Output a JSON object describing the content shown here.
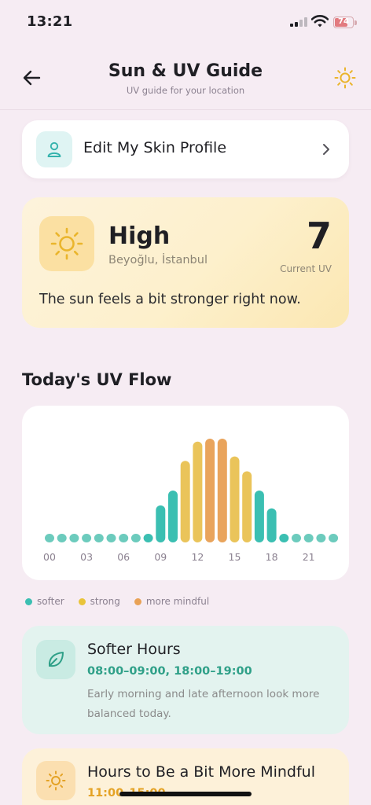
{
  "status_bar": {
    "time": "13:21",
    "battery": "74",
    "battery_level": 0.74
  },
  "header": {
    "title": "Sun & UV Guide",
    "subtitle": "UV guide for your location",
    "back_icon": "arrow-left-icon",
    "action_icon": "sun-icon"
  },
  "profile_card": {
    "label": "Edit My Skin Profile",
    "icon": "person-icon",
    "chevron": "chevron-right-icon"
  },
  "uv_card": {
    "level": "High",
    "location": "Beyoğlu, İstanbul",
    "value": "7",
    "value_label": "Current UV",
    "message": "The sun feels a bit stronger right now."
  },
  "flow": {
    "title": "Today's UV Flow",
    "legend": [
      {
        "label": "softer",
        "color": "#3bbfb2"
      },
      {
        "label": "strong",
        "color": "#e9c43a"
      },
      {
        "label": "more mindful",
        "color": "#e9a256"
      }
    ]
  },
  "chart_data": {
    "type": "bar",
    "x": [
      "00",
      "01",
      "02",
      "03",
      "04",
      "05",
      "06",
      "07",
      "08",
      "09",
      "10",
      "11",
      "12",
      "13",
      "14",
      "15",
      "16",
      "17",
      "18",
      "19",
      "20",
      "21",
      "22",
      "23"
    ],
    "values": [
      0,
      0,
      0,
      0,
      0,
      0,
      0,
      0,
      0.5,
      2.5,
      3.5,
      5.5,
      6.8,
      7,
      7,
      5.8,
      4.8,
      3.5,
      2.3,
      0.5,
      0,
      0,
      0,
      0
    ],
    "levels": [
      "softer",
      "softer",
      "softer",
      "softer",
      "softer",
      "softer",
      "softer",
      "softer",
      "softer",
      "softer",
      "softer",
      "strong",
      "strong",
      "more mindful",
      "more mindful",
      "strong",
      "strong",
      "softer",
      "softer",
      "softer",
      "softer",
      "softer",
      "softer",
      "softer"
    ],
    "tick_labels": [
      "00",
      "03",
      "06",
      "09",
      "12",
      "15",
      "18",
      "21"
    ],
    "colors": {
      "softer": "#3bbfb2",
      "strong": "#eac45a",
      "more mindful": "#e9a45c"
    },
    "ylim": [
      0,
      7
    ]
  },
  "softer_hours": {
    "title": "Softer Hours",
    "times": "08:00–09:00, 18:00–19:00",
    "description": "Early morning and late afternoon look more balanced today.",
    "icon": "leaf-icon"
  },
  "mindful_hours": {
    "title": "Hours to Be a Bit More Mindful",
    "times": "11:00–15:00",
    "icon": "sun-icon"
  }
}
